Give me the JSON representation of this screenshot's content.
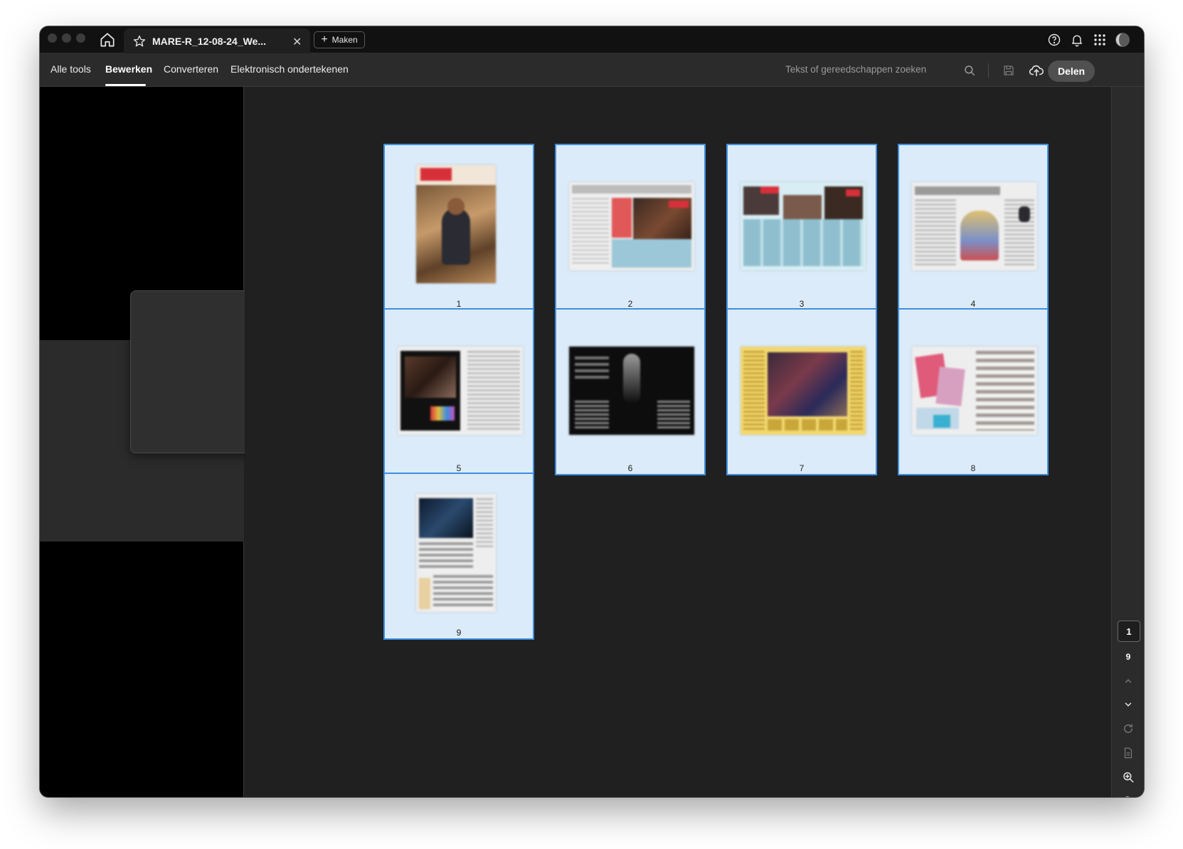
{
  "tab": {
    "title": "MARE-R_12-08-24_We...",
    "close_glyph": "✕",
    "new_button": "Maken"
  },
  "menu": [
    "Alle tools",
    "Bewerken",
    "Converteren",
    "Elektronisch ondertekenen"
  ],
  "menu_active": "Bewerken",
  "search": {
    "placeholder": "Tekst of gereedschappen zoeken"
  },
  "share_button": "Delen",
  "pages": [
    {
      "number": "1",
      "layout": "single"
    },
    {
      "number": "2",
      "layout": "spread"
    },
    {
      "number": "3",
      "layout": "spread"
    },
    {
      "number": "4",
      "layout": "spread"
    },
    {
      "number": "5",
      "layout": "spread"
    },
    {
      "number": "6",
      "layout": "spread"
    },
    {
      "number": "7",
      "layout": "spread"
    },
    {
      "number": "8",
      "layout": "spread"
    },
    {
      "number": "9",
      "layout": "single"
    }
  ],
  "page_nav": {
    "current": "1",
    "total": "9"
  },
  "colors": {
    "selection_border": "#3e8fe0",
    "selection_fill": "#dcebf9",
    "accent_red": "#d8303a"
  },
  "icons": [
    "home-icon",
    "star-icon",
    "help-icon",
    "bell-icon",
    "apps-grid-icon",
    "avatar",
    "search-icon",
    "save-icon",
    "cloud-upload-icon",
    "print-icon",
    "chevron-up-icon",
    "chevron-down-icon",
    "rotate-icon",
    "page-icon",
    "zoom-in-icon",
    "zoom-out-icon"
  ]
}
